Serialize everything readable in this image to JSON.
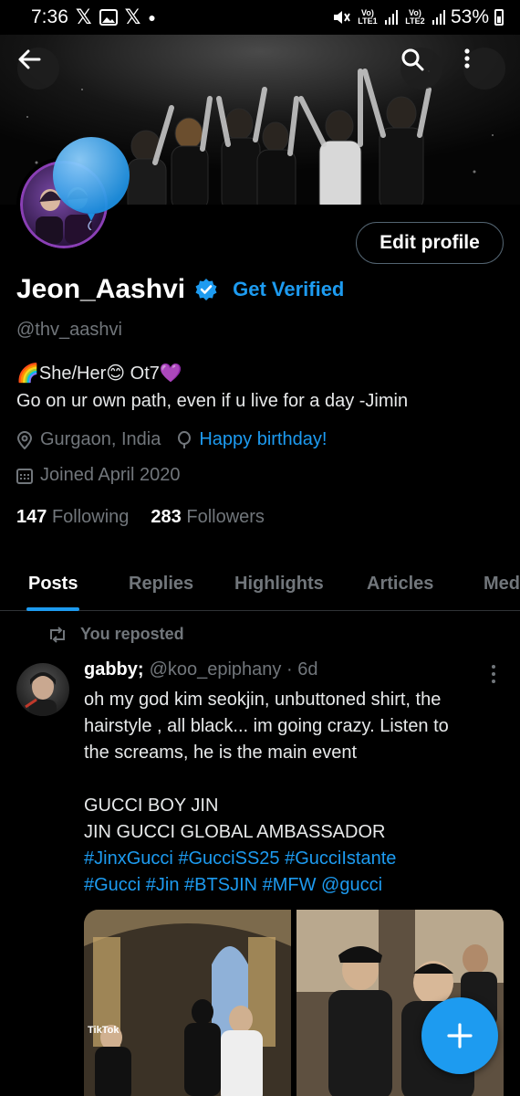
{
  "status_bar": {
    "time": "7:36",
    "battery": "53%",
    "sim1_label": "Vo) LTE1",
    "sim2_label": "Vo) LTE2"
  },
  "profile": {
    "edit_button": "Edit profile",
    "display_name": "Jeon_Aashvi",
    "get_verified": "Get Verified",
    "handle": "@thv_aashvi",
    "bio_line1": "🌈She/Her😊 Ot7💜",
    "bio_line2": "Go on ur own path, even if u live for a day -Jimin",
    "location": "Gurgaon, India",
    "birthday_link": "Happy birthday!",
    "joined": "Joined April 2020",
    "following_count": "147",
    "following_label": "Following",
    "followers_count": "283",
    "followers_label": "Followers"
  },
  "tabs": [
    {
      "label": "Posts",
      "active": true
    },
    {
      "label": "Replies"
    },
    {
      "label": "Highlights"
    },
    {
      "label": "Articles"
    },
    {
      "label": "Media"
    }
  ],
  "post": {
    "repost_label": "You reposted",
    "author": "gabby;",
    "handle_time": "@koo_epiphany · 6d",
    "text_lines": [
      "oh my god kim seokjin, unbuttoned shirt, the",
      "hairstyle , all black... im going crazy. Listen to",
      "the screams, he is the main event",
      "",
      "GUCCI BOY JIN",
      "JIN GUCCI GLOBAL AMBASSADOR"
    ],
    "hashtags_line1": "#JinxGucci #GucciSS25 #GucciIstante",
    "hashtags_line2": "#Gucci #Jin #BTSJIN #MFW @gucci",
    "media_badge": "TikTok"
  },
  "colors": {
    "accent": "#1d9bf0",
    "muted": "#71767b",
    "text": "#e7e9ea",
    "background": "#000000"
  },
  "icons": [
    "back-arrow-icon",
    "search-icon",
    "more-vertical-icon",
    "verified-badge-icon",
    "location-pin-icon",
    "balloon-icon",
    "calendar-icon",
    "repost-icon",
    "compose-plus-icon"
  ]
}
